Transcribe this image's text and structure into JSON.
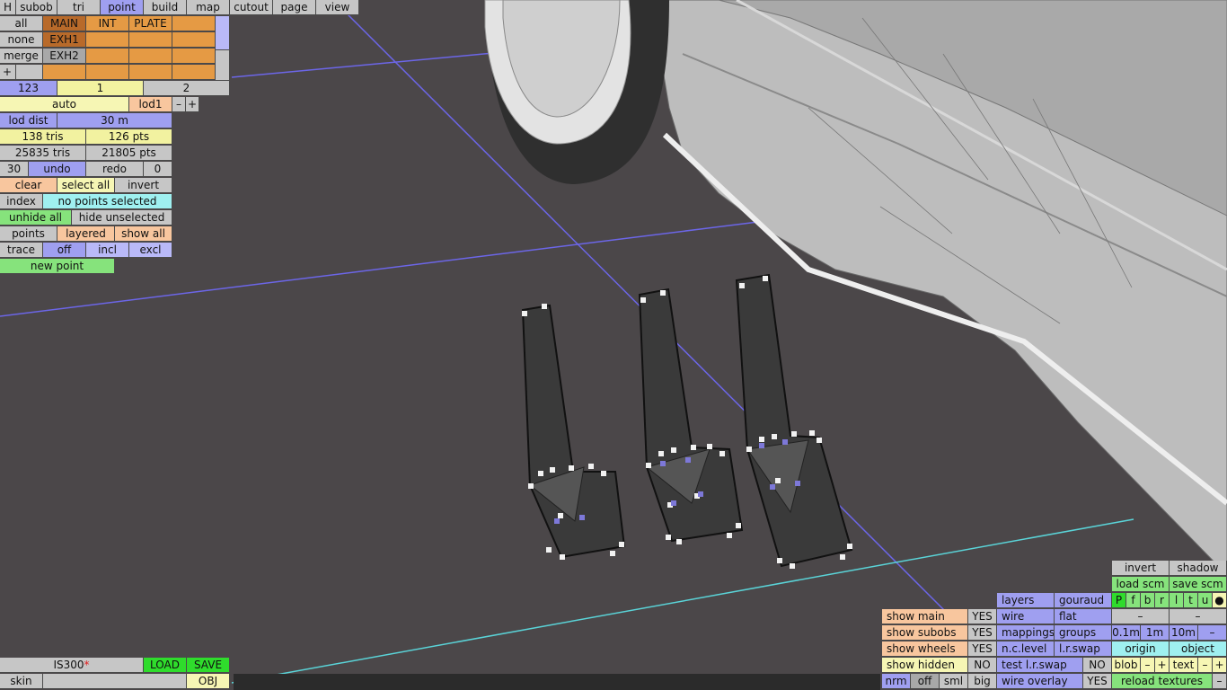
{
  "menu": {
    "h": "H",
    "tabs": [
      "subob",
      "tri",
      "point",
      "build",
      "map",
      "cutout",
      "page",
      "view"
    ],
    "active": "point"
  },
  "subob": {
    "left_buttons": [
      "all",
      "none",
      "merge",
      "+"
    ],
    "row1": [
      "MAIN",
      "INT",
      "PLATE"
    ],
    "row2": [
      "EXH1"
    ],
    "row3": [
      "EXH2"
    ]
  },
  "lod": {
    "tab_a": "123",
    "tab_b": "1",
    "tab_c": "2",
    "auto": "auto",
    "lod_name": "lod1",
    "minus": "–",
    "plus": "+",
    "dist_label": "lod dist",
    "dist_value": "30 m",
    "tris": "138 tris",
    "pts": "126 pts",
    "total_tris": "25835 tris",
    "total_pts": "21805 pts",
    "undo_count": "30",
    "undo": "undo",
    "redo": "redo",
    "redo_count": "0"
  },
  "select": {
    "clear": "clear",
    "select_all": "select all",
    "invert": "invert",
    "index": "index",
    "status": "no points selected",
    "unhide_all": "unhide all",
    "hide_unselected": "hide unselected",
    "points": "points",
    "layered": "layered",
    "show_all": "show all",
    "trace": "trace",
    "off": "off",
    "incl": "incl",
    "excl": "excl",
    "new_point": "new point"
  },
  "bottom_left": {
    "model": "IS300",
    "modified_mark": "*",
    "load": "LOAD",
    "save": "SAVE",
    "skin": "skin",
    "obj": "OBJ"
  },
  "right_panel": {
    "invert": "invert",
    "shadow": "shadow",
    "load_scm": "load scm",
    "save_scm": "save scm",
    "flags": [
      "P",
      "f",
      "b",
      "r",
      "l",
      "t",
      "u",
      "●"
    ],
    "dash": "–",
    "layers": "layers",
    "gouraud": "gouraud",
    "wire": "wire",
    "flat": "flat",
    "mappings": "mappings",
    "groups": "groups",
    "g01": "0.1m",
    "g1": "1m",
    "g10": "10m",
    "nclevel": "n.c.level",
    "lrswap": "l.r.swap",
    "origin": "origin",
    "object": "object",
    "test_lrswap": "test l.r.swap",
    "no": "NO",
    "blob": "blob",
    "text": "text",
    "pm_minus": "–",
    "pm_plus": "+",
    "wire_overlay": "wire overlay",
    "yes": "YES",
    "reload_textures": "reload textures",
    "show_main": "show main",
    "show_subobs": "show subobs",
    "show_wheels": "show wheels",
    "show_hidden": "show hidden",
    "nrm": "nrm",
    "off": "off",
    "sml": "sml",
    "big": "big"
  },
  "colors": {
    "background": "#4b4749",
    "accent_blue": "#9f9ff0",
    "accent_orange": "#e59a44",
    "grid_blue": "#6c66e8",
    "grid_cyan": "#5ad4d8"
  }
}
